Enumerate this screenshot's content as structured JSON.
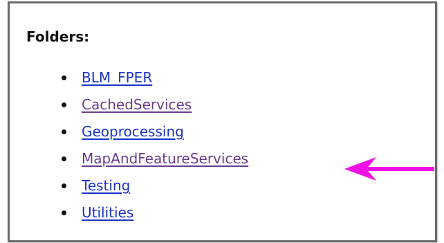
{
  "folders": {
    "heading": "Folders:",
    "items": [
      {
        "label": "BLM_FPER",
        "link_color": "#1a33c8"
      },
      {
        "label": "CachedServices",
        "link_color": "#6a3c8c"
      },
      {
        "label": "Geoprocessing",
        "link_color": "#1a33c8"
      },
      {
        "label": "MapAndFeatureServices",
        "link_color": "#6a3c8c"
      },
      {
        "label": "Testing",
        "link_color": "#1a33c8"
      },
      {
        "label": "Utilities",
        "link_color": "#1a33c8"
      }
    ]
  },
  "annotation": {
    "arrow_icon": "arrow-left-icon",
    "arrow_color": "#f20fe6",
    "points_to": "MapAndFeatureServices"
  }
}
